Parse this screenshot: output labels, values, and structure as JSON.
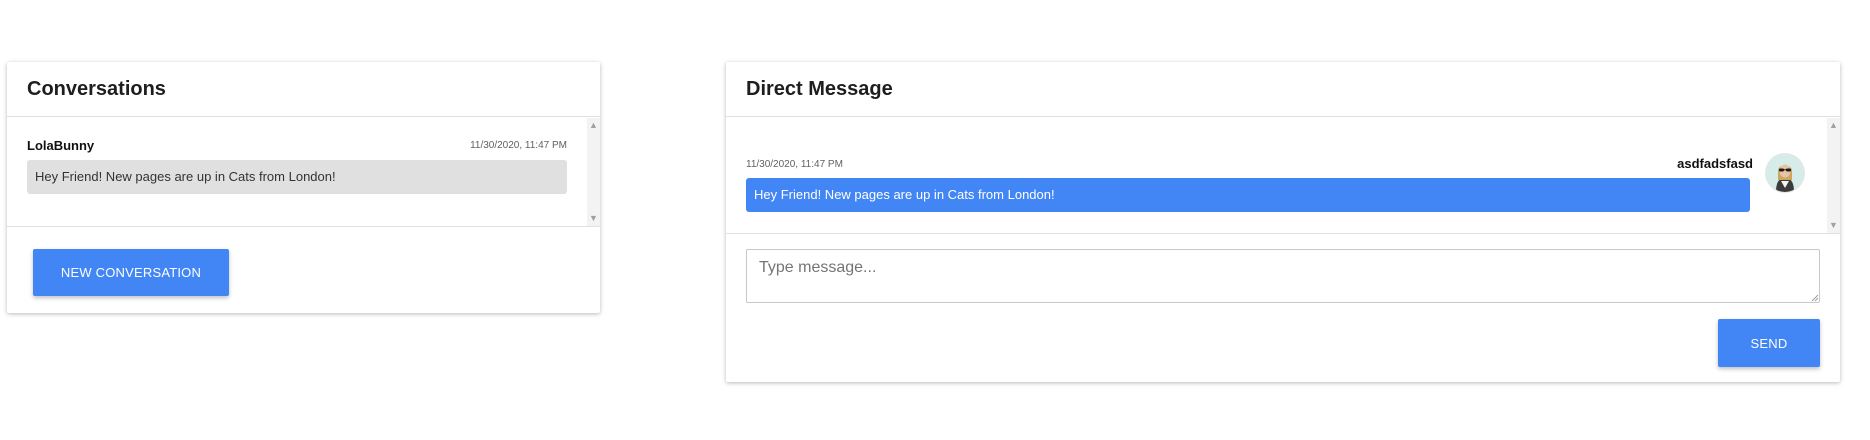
{
  "conversations": {
    "title": "Conversations",
    "items": [
      {
        "name": "LolaBunny",
        "time": "11/30/2020, 11:47 PM",
        "preview": "Hey Friend! New pages are up in Cats from London!"
      }
    ],
    "new_button_label": "NEW CONVERSATION"
  },
  "direct_message": {
    "title": "Direct Message",
    "messages": [
      {
        "time": "11/30/2020, 11:47 PM",
        "sender": "asdfadsfasd",
        "text": "Hey Friend! New pages are up in Cats from London!"
      }
    ],
    "input_placeholder": "Type message...",
    "send_label": "SEND"
  },
  "colors": {
    "accent": "#4285f4",
    "preview_bg": "#e0e0e0",
    "divider": "#e0e0e0"
  },
  "icons": {
    "scroll_up": "scroll-up-arrow",
    "scroll_down": "scroll-down-arrow",
    "avatar": "user-avatar"
  }
}
